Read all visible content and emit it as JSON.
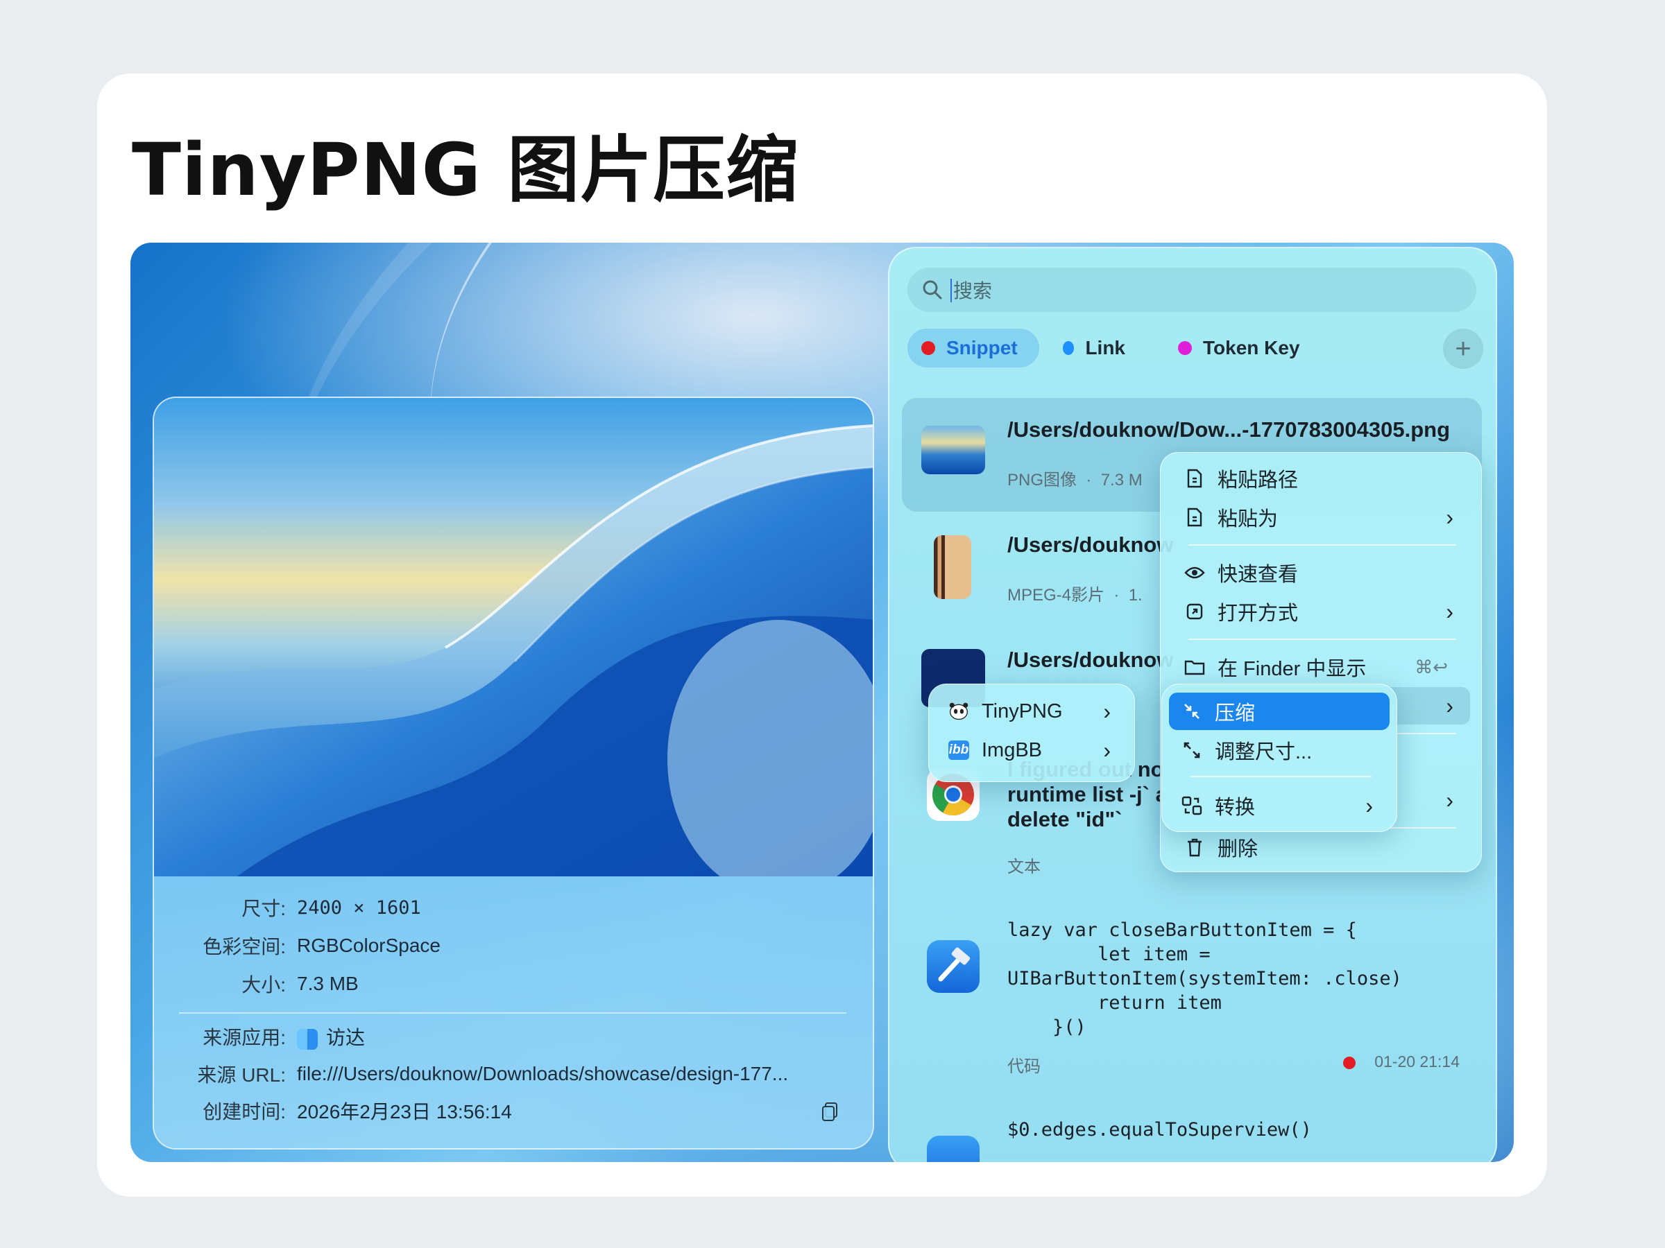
{
  "page_title": "TinyPNG 图片压缩",
  "preview": {
    "meta": [
      {
        "label": "尺寸:",
        "value": "2400 × 1601",
        "mono": true
      },
      {
        "label": "色彩空间:",
        "value": "RGBColorSpace"
      },
      {
        "label": "大小:",
        "value": "7.3 MB"
      }
    ],
    "source_app_label": "来源应用:",
    "source_app_value": "访达",
    "source_url_label": "来源 URL:",
    "source_url_value": "file:///Users/douknow/Downloads/showcase/design-177...",
    "created_label": "创建时间:",
    "created_value": "2026年2月23日 13:56:14"
  },
  "search": {
    "placeholder": "搜索"
  },
  "tabs": [
    {
      "label": "Snippet",
      "color": "#e31b23"
    },
    {
      "label": "Link",
      "color": "#1e90ff"
    },
    {
      "label": "Token Key",
      "color": "#e020d8"
    }
  ],
  "add_button": "+",
  "items": {
    "png": {
      "title": "/Users/douknow/Dow...-1770783004305.png",
      "type": "PNG图像",
      "dot": "·",
      "size": "7.3 M"
    },
    "mpeg": {
      "title": "/Users/douknow",
      "type": "MPEG-4影片",
      "dot": "·",
      "size": "1."
    },
    "third": {
      "title": "/Users/douknow"
    },
    "text": {
      "line1": "I figured out no",
      "line2": "runtime list -j` a",
      "line3": "delete \"id\"`",
      "type": "文本"
    },
    "code": {
      "code": "lazy var closeBarButtonItem = {\n        let item =\nUIBarButtonItem(systemItem: .close)\n        return item\n    }()",
      "type": "代码",
      "time": "01-20 21:14"
    },
    "last": {
      "code": "$0.edges.equalToSuperview()"
    }
  },
  "context_menu": {
    "paste_path": "粘贴路径",
    "paste_as": "粘贴为",
    "quick_look": "快速查看",
    "open_with": "打开方式",
    "show_in_finder": "在 Finder 中显示",
    "finder_shortcut": "⌘↩",
    "delete": "删除"
  },
  "plugin_menu": {
    "tinypng": "TinyPNG",
    "imgbb": "ImgBB"
  },
  "tinypng_menu": {
    "compress": "压缩",
    "resize": "调整尺寸...",
    "convert": "转换"
  },
  "colors": {
    "accent": "#1a86ee",
    "panel": "#a8ecf4"
  }
}
